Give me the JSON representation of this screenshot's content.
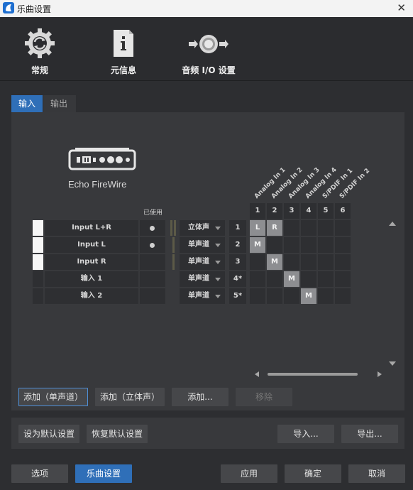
{
  "window": {
    "title": "乐曲设置",
    "close_glyph": "✕"
  },
  "top_tabs": [
    {
      "label": "常规",
      "icon": "gear-refresh-icon"
    },
    {
      "label": "元信息",
      "icon": "info-document-icon"
    },
    {
      "label": "音频 I/O 设置",
      "icon": "audio-io-icon"
    }
  ],
  "sub_tabs": [
    {
      "label": "输入",
      "active": true
    },
    {
      "label": "输出",
      "active": false
    }
  ],
  "device": {
    "name": "Echo FireWire"
  },
  "table": {
    "used_header": "已使用",
    "rows": [
      {
        "swatch": "white",
        "name": "Input L+R",
        "used": true,
        "mode": "立体声",
        "num": "1"
      },
      {
        "swatch": "white",
        "name": "Input L",
        "used": true,
        "mode": "单声道",
        "num": "2"
      },
      {
        "swatch": "white",
        "name": "Input R",
        "used": false,
        "mode": "单声道",
        "num": "3"
      },
      {
        "swatch": "dark",
        "name": "输入 1",
        "used": false,
        "mode": "单声道",
        "num": "4*"
      },
      {
        "swatch": "dark",
        "name": "输入 2",
        "used": false,
        "mode": "单声道",
        "num": "5*"
      }
    ]
  },
  "matrix": {
    "channels": [
      "Analog In 1",
      "Analog In 2",
      "Analog In 3",
      "Analog In 4",
      "S/PDIF In 1",
      "S/PDIF In 2"
    ],
    "columns": [
      "1",
      "2",
      "3",
      "4",
      "5",
      "6"
    ],
    "cells": [
      [
        "L",
        "R",
        "",
        "",
        "",
        ""
      ],
      [
        "M",
        "",
        "",
        "",
        "",
        ""
      ],
      [
        "",
        "M",
        "",
        "",
        "",
        ""
      ],
      [
        "",
        "",
        "M",
        "",
        "",
        ""
      ],
      [
        "",
        "",
        "",
        "M",
        "",
        ""
      ]
    ]
  },
  "buttons": {
    "add_mono": "添加（单声道）",
    "add_stereo": "添加（立体声）",
    "add": "添加...",
    "remove": "移除",
    "set_default": "设为默认设置",
    "restore_default": "恢复默认设置",
    "import": "导入...",
    "export": "导出...",
    "options": "选项",
    "song_setup": "乐曲设置",
    "apply": "应用",
    "ok": "确定",
    "cancel": "取消"
  },
  "colors": {
    "accent": "#2f6fb8",
    "background": "#2d2e31",
    "panel": "#38393c"
  }
}
